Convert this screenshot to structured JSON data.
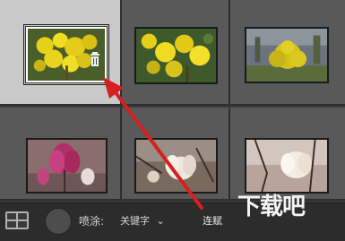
{
  "toolbar": {
    "spray_label": "喷涂:",
    "keyword_label": "关键字",
    "keyword_chevron": "⌄",
    "connect_label": "连赋"
  },
  "watermark": "下载吧",
  "colors": {
    "accent": "#d42020",
    "selected_bg": "#c9c9c9",
    "cell_bg": "#595959"
  },
  "icons": [
    "trash-icon",
    "grid-view-icon"
  ]
}
